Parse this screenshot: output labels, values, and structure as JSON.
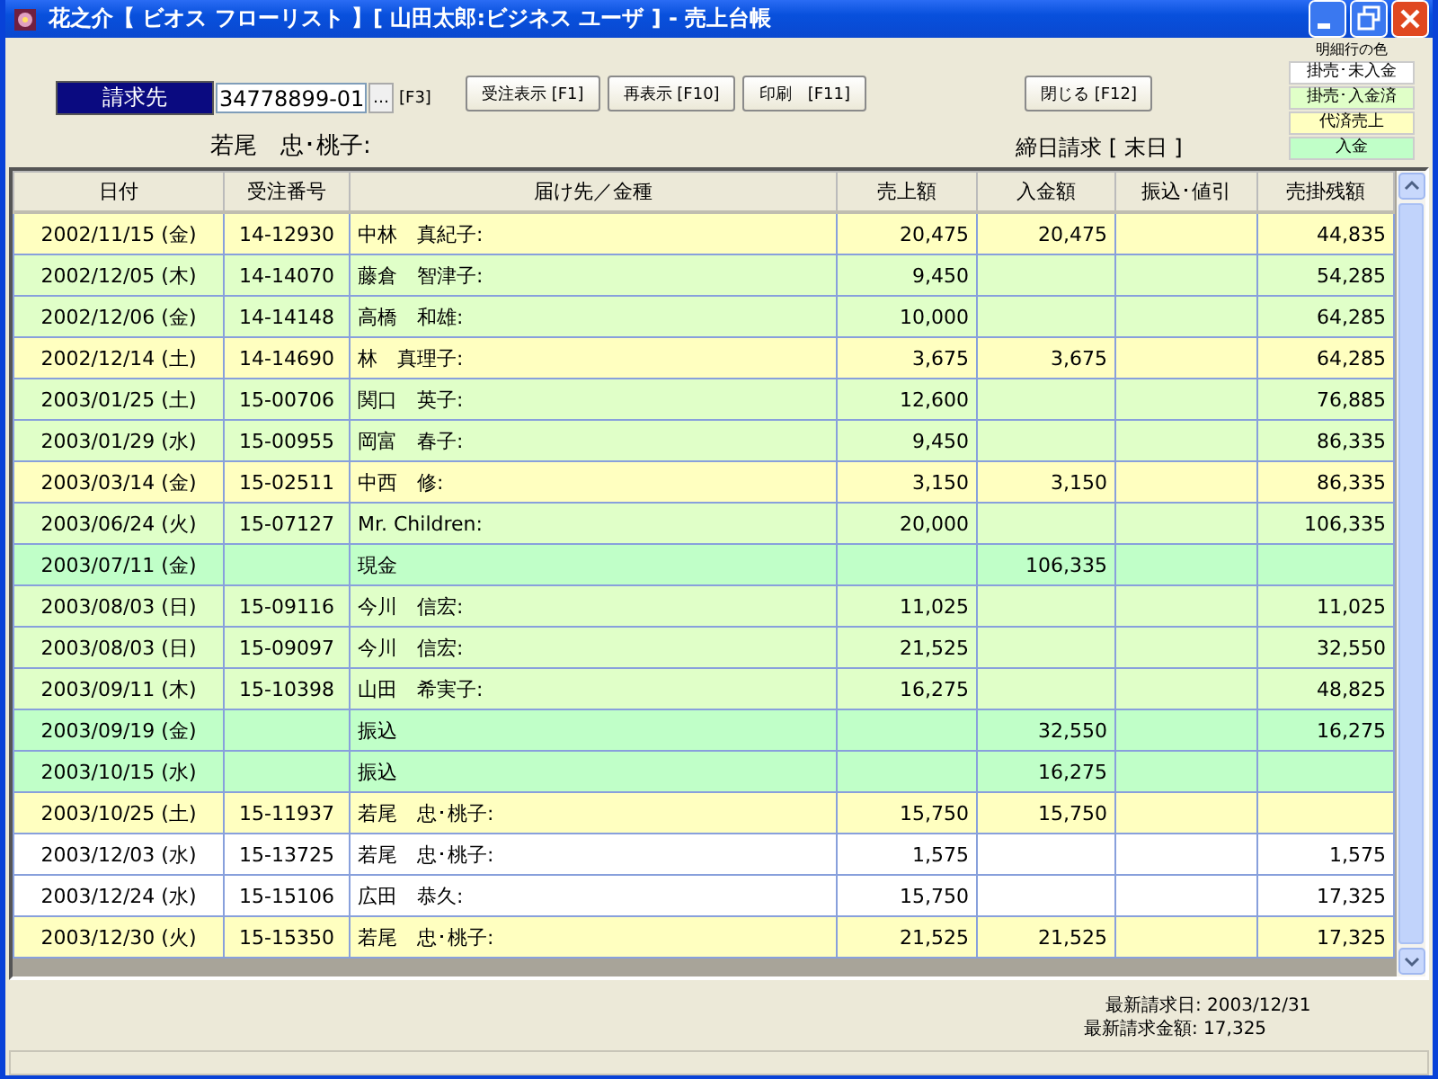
{
  "window": {
    "title": "花之介【 ビオス フローリスト 】[ 山田太郎:ビジネス ユーザ ] - 売上台帳"
  },
  "billing": {
    "label": "請求先",
    "value": "34778899-01",
    "browse": "…",
    "shortcut": "[F3]",
    "customer": "若尾　忠･桃子:"
  },
  "buttons": [
    "受注表示 [F1]",
    "再表示 [F10]",
    "印刷　[F11]",
    "閉じる [F12]"
  ],
  "closing": "締日請求 [ 末日 ]",
  "legend": {
    "title": "明細行の色",
    "items": [
      {
        "label": "掛売･未入金",
        "color": "#ffffff"
      },
      {
        "label": "掛売･入金済",
        "color": "#e0ffc8"
      },
      {
        "label": "代済売上",
        "color": "#ffffc0"
      },
      {
        "label": "入金",
        "color": "#c0ffc8"
      }
    ]
  },
  "table": {
    "columns": [
      "日付",
      "受注番号",
      "届け先／金種",
      "売上額",
      "入金額",
      "振込･値引",
      "売掛残額"
    ],
    "rows": [
      {
        "color": "#ffffc0",
        "cells": [
          "2002/11/15 (金)",
          "14-12930",
          "中林　真紀子:",
          "20,475",
          "20,475",
          "",
          "44,835"
        ]
      },
      {
        "color": "#e0ffc8",
        "cells": [
          "2002/12/05 (木)",
          "14-14070",
          "藤倉　智津子:",
          "9,450",
          "",
          "",
          "54,285"
        ]
      },
      {
        "color": "#e0ffc8",
        "cells": [
          "2002/12/06 (金)",
          "14-14148",
          "高橋　和雄:",
          "10,000",
          "",
          "",
          "64,285"
        ]
      },
      {
        "color": "#ffffc0",
        "cells": [
          "2002/12/14 (土)",
          "14-14690",
          "林　真理子:",
          "3,675",
          "3,675",
          "",
          "64,285"
        ]
      },
      {
        "color": "#e0ffc8",
        "cells": [
          "2003/01/25 (土)",
          "15-00706",
          "関口　英子:",
          "12,600",
          "",
          "",
          "76,885"
        ]
      },
      {
        "color": "#e0ffc8",
        "cells": [
          "2003/01/29 (水)",
          "15-00955",
          "岡富　春子:",
          "9,450",
          "",
          "",
          "86,335"
        ]
      },
      {
        "color": "#ffffc0",
        "cells": [
          "2003/03/14 (金)",
          "15-02511",
          "中西　修:",
          "3,150",
          "3,150",
          "",
          "86,335"
        ]
      },
      {
        "color": "#e0ffc8",
        "cells": [
          "2003/06/24 (火)",
          "15-07127",
          "Mr. Children:",
          "20,000",
          "",
          "",
          "106,335"
        ]
      },
      {
        "color": "#c0ffc8",
        "cells": [
          "2003/07/11 (金)",
          "",
          "現金",
          "",
          "106,335",
          "",
          ""
        ]
      },
      {
        "color": "#e0ffc8",
        "cells": [
          "2003/08/03 (日)",
          "15-09116",
          "今川　信宏:",
          "11,025",
          "",
          "",
          "11,025"
        ]
      },
      {
        "color": "#e0ffc8",
        "cells": [
          "2003/08/03 (日)",
          "15-09097",
          "今川　信宏:",
          "21,525",
          "",
          "",
          "32,550"
        ]
      },
      {
        "color": "#e0ffc8",
        "cells": [
          "2003/09/11 (木)",
          "15-10398",
          "山田　希実子:",
          "16,275",
          "",
          "",
          "48,825"
        ]
      },
      {
        "color": "#c0ffc8",
        "cells": [
          "2003/09/19 (金)",
          "",
          "振込",
          "",
          "32,550",
          "",
          "16,275"
        ]
      },
      {
        "color": "#c0ffc8",
        "cells": [
          "2003/10/15 (水)",
          "",
          "振込",
          "",
          "16,275",
          "",
          ""
        ]
      },
      {
        "color": "#ffffc0",
        "cells": [
          "2003/10/25 (土)",
          "15-11937",
          "若尾　忠･桃子:",
          "15,750",
          "15,750",
          "",
          ""
        ]
      },
      {
        "color": "#ffffff",
        "cells": [
          "2003/12/03 (水)",
          "15-13725",
          "若尾　忠･桃子:",
          "1,575",
          "",
          "",
          "1,575"
        ]
      },
      {
        "color": "#ffffff",
        "cells": [
          "2003/12/24 (水)",
          "15-15106",
          "広田　恭久:",
          "15,750",
          "",
          "",
          "17,325"
        ]
      },
      {
        "color": "#ffffc0",
        "cells": [
          "2003/12/30 (火)",
          "15-15350",
          "若尾　忠･桃子:",
          "21,525",
          "21,525",
          "",
          "17,325"
        ]
      }
    ]
  },
  "summary": [
    "最新請求日: 2003/12/31",
    "最新請求金額: 17,325"
  ]
}
